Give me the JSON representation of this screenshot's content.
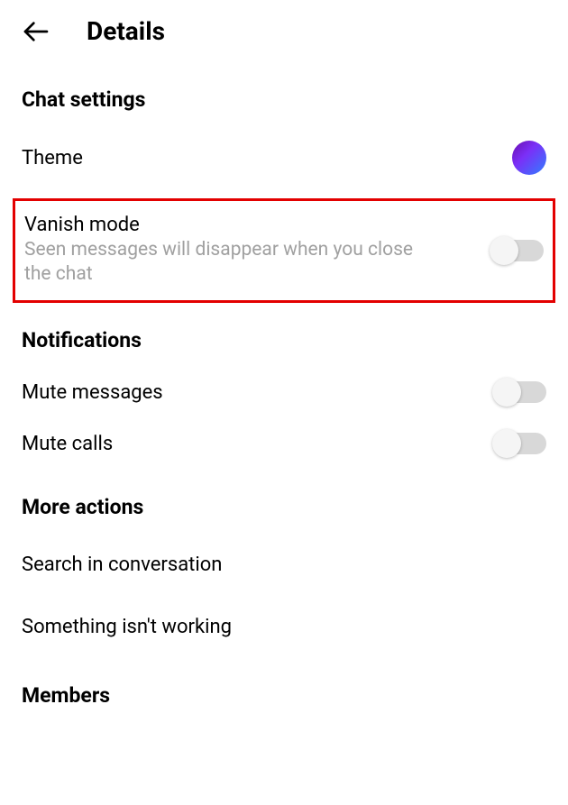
{
  "header": {
    "title": "Details"
  },
  "sections": {
    "chatSettings": {
      "title": "Chat settings",
      "theme": {
        "label": "Theme"
      },
      "vanishMode": {
        "label": "Vanish mode",
        "description": "Seen messages will disappear when you close the chat"
      }
    },
    "notifications": {
      "title": "Notifications",
      "muteMessages": {
        "label": "Mute messages"
      },
      "muteCalls": {
        "label": "Mute calls"
      }
    },
    "moreActions": {
      "title": "More actions",
      "search": {
        "label": "Search in conversation"
      },
      "report": {
        "label": "Something isn't working"
      }
    },
    "members": {
      "title": "Members"
    }
  }
}
